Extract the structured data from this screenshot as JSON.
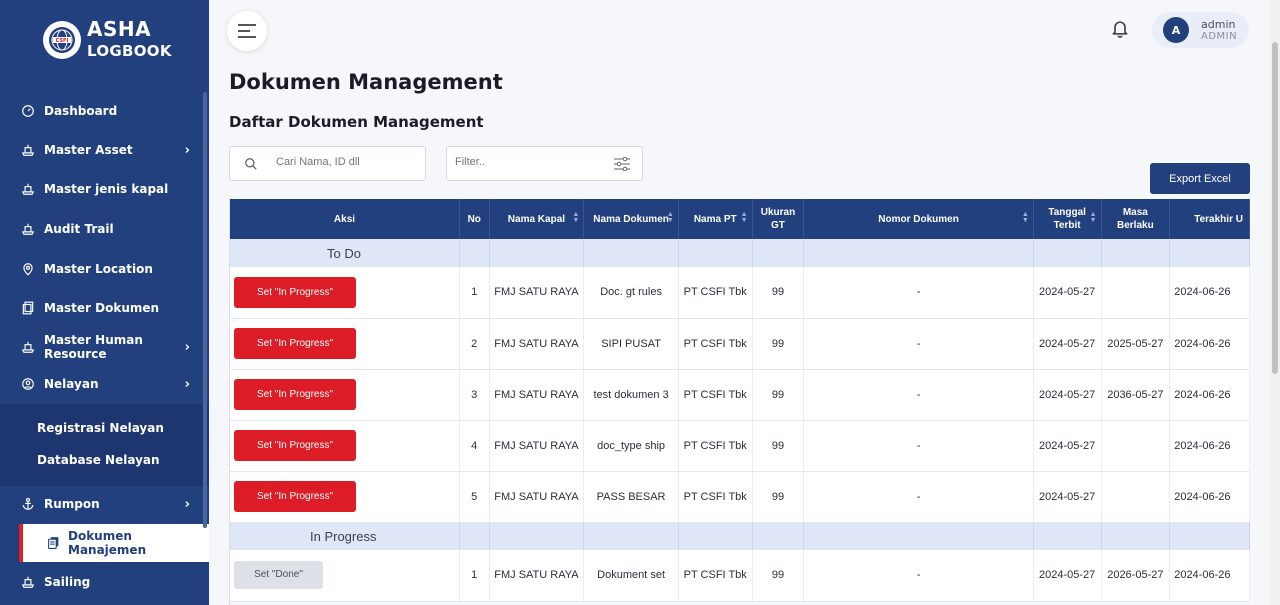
{
  "brand": {
    "line1": "ASHA",
    "line2": "LOGBOOK"
  },
  "sidebar": {
    "items": [
      {
        "label": "Dashboard",
        "icon": "dashboard-icon",
        "chevron": false
      },
      {
        "label": "Master Asset",
        "icon": "ship-icon",
        "chevron": true
      },
      {
        "label": "Master jenis kapal",
        "icon": "ship-icon",
        "chevron": false
      },
      {
        "label": "Audit Trail",
        "icon": "ship-icon",
        "chevron": false
      },
      {
        "label": "Master Location",
        "icon": "location-pin-icon",
        "chevron": false
      },
      {
        "label": "Master Dokumen",
        "icon": "document-icon",
        "chevron": false
      },
      {
        "label": "Master Human Resource",
        "icon": "ship-icon",
        "chevron": true
      },
      {
        "label": "Nelayan",
        "icon": "user-circle-icon",
        "chevron": true
      }
    ],
    "sub_items": [
      "Registrasi Nelayan",
      "Database Nelayan"
    ],
    "rumpon": {
      "label": "Rumpon",
      "icon": "anchor-icon"
    },
    "active": {
      "label": "Dokumen Manajemen",
      "icon": "document-icon"
    },
    "sailing": {
      "label": "Sailing",
      "icon": "ship-icon"
    }
  },
  "header": {
    "user_name": "admin",
    "user_role": "ADMIN",
    "avatar_initial": "A"
  },
  "page": {
    "title": "Dokumen Management",
    "section_title": "Daftar Dokumen Management"
  },
  "search": {
    "placeholder": "Cari Nama, ID dll",
    "value": ""
  },
  "filter": {
    "placeholder": "Filter..",
    "value": ""
  },
  "export_label": "Export Excel",
  "table": {
    "columns": [
      "Aksi",
      "No",
      "Nama Kapal",
      "Nama Dokumen",
      "Nama PT",
      "Ukuran GT",
      "Nomor Dokumen",
      "Tanggal Terbit",
      "Masa Berlaku",
      "Terakhir U"
    ],
    "groups": [
      {
        "name": "To Do",
        "action_label": "Set \"In Progress\"",
        "rows": [
          {
            "no": "1",
            "kapal": "FMJ SATU RAYA",
            "dokumen": "Doc. gt rules",
            "pt": "PT CSFI Tbk",
            "gt": "99",
            "nomor": "-",
            "terbit": "2024-05-27",
            "berlaku": "",
            "terakhir": "2024-06-26"
          },
          {
            "no": "2",
            "kapal": "FMJ SATU RAYA",
            "dokumen": "SIPI PUSAT",
            "pt": "PT CSFI Tbk",
            "gt": "99",
            "nomor": "-",
            "terbit": "2024-05-27",
            "berlaku": "2025-05-27",
            "terakhir": "2024-06-26"
          },
          {
            "no": "3",
            "kapal": "FMJ SATU RAYA",
            "dokumen": "test dokumen 3",
            "pt": "PT CSFI Tbk",
            "gt": "99",
            "nomor": "-",
            "terbit": "2024-05-27",
            "berlaku": "2036-05-27",
            "terakhir": "2024-06-26"
          },
          {
            "no": "4",
            "kapal": "FMJ SATU RAYA",
            "dokumen": "doc_type ship",
            "pt": "PT CSFI Tbk",
            "gt": "99",
            "nomor": "-",
            "terbit": "2024-05-27",
            "berlaku": "",
            "terakhir": "2024-06-26"
          },
          {
            "no": "5",
            "kapal": "FMJ SATU RAYA",
            "dokumen": "PASS BESAR",
            "pt": "PT CSFI Tbk",
            "gt": "99",
            "nomor": "-",
            "terbit": "2024-05-27",
            "berlaku": "",
            "terakhir": "2024-06-26"
          }
        ]
      },
      {
        "name": "In Progress",
        "action_label": "Set \"Done\"",
        "rows": [
          {
            "no": "1",
            "kapal": "FMJ SATU RAYA",
            "dokumen": "Dokument set",
            "pt": "PT CSFI Tbk",
            "gt": "99",
            "nomor": "-",
            "terbit": "2024-05-27",
            "berlaku": "2026-05-27",
            "terakhir": "2024-06-26"
          }
        ]
      }
    ]
  },
  "colors": {
    "primary": "#22407e",
    "danger": "#dc1c26",
    "group_bg": "#dfe6f7"
  }
}
